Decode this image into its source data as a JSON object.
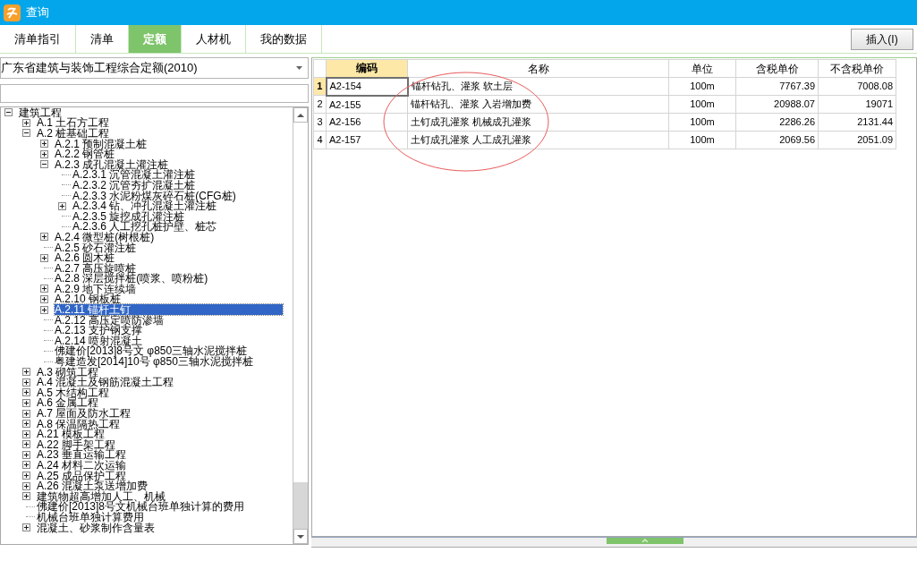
{
  "window": {
    "title": "查询"
  },
  "tabs": [
    {
      "label": "清单指引",
      "selected": false
    },
    {
      "label": "清单",
      "selected": false
    },
    {
      "label": "定额",
      "selected": true
    },
    {
      "label": "人材机",
      "selected": false
    },
    {
      "label": "我的数据",
      "selected": false
    }
  ],
  "insert_button": "插入(I)",
  "library_select": {
    "value": "广东省建筑与装饰工程综合定额(2010)"
  },
  "tree": [
    {
      "label": "建筑工程",
      "kind": "branch",
      "expanded": true,
      "selected": false,
      "children": [
        {
          "label": "A.1 土石方工程",
          "kind": "branch",
          "expanded": false,
          "selected": false
        },
        {
          "label": "A.2 桩基础工程",
          "kind": "branch",
          "expanded": true,
          "selected": false,
          "children": [
            {
              "label": "A.2.1 预制混凝土桩",
              "kind": "branch",
              "expanded": false,
              "selected": false
            },
            {
              "label": "A.2.2 钢管桩",
              "kind": "branch",
              "expanded": false,
              "selected": false
            },
            {
              "label": "A.2.3 成孔混凝土灌注桩",
              "kind": "branch",
              "expanded": true,
              "selected": false,
              "children": [
                {
                  "label": "A.2.3.1 沉管混凝土灌注桩",
                  "kind": "leaf",
                  "selected": false
                },
                {
                  "label": "A.2.3.2 沉管夯扩混凝土桩",
                  "kind": "leaf",
                  "selected": false
                },
                {
                  "label": "A.2.3.3 水泥粉煤灰碎石桩(CFG桩)",
                  "kind": "leaf",
                  "selected": false
                },
                {
                  "label": "A.2.3.4 钻、冲孔混凝土灌注桩",
                  "kind": "branch",
                  "expanded": false,
                  "selected": false
                },
                {
                  "label": "A.2.3.5 旋挖成孔灌注桩",
                  "kind": "leaf",
                  "selected": false
                },
                {
                  "label": "A.2.3.6 人工挖孔桩护壁、桩芯",
                  "kind": "leaf",
                  "selected": false
                }
              ]
            },
            {
              "label": "A.2.4 微型桩(树根桩)",
              "kind": "branch",
              "expanded": false,
              "selected": false
            },
            {
              "label": "A.2.5 砂石灌注桩",
              "kind": "leaf",
              "selected": false
            },
            {
              "label": "A.2.6 圆木桩",
              "kind": "branch",
              "expanded": false,
              "selected": false
            },
            {
              "label": "A.2.7 高压旋喷桩",
              "kind": "leaf",
              "selected": false
            },
            {
              "label": "A.2.8 深层搅拌桩(喷浆、喷粉桩)",
              "kind": "leaf",
              "selected": false
            },
            {
              "label": "A.2.9 地下连续墙",
              "kind": "branch",
              "expanded": false,
              "selected": false
            },
            {
              "label": "A.2.10 钢板桩",
              "kind": "branch",
              "expanded": false,
              "selected": false
            },
            {
              "label": "A.2.11 锚杆土钉",
              "kind": "branch",
              "expanded": false,
              "selected": true
            },
            {
              "label": "A.2.12 高压定喷防渗墙",
              "kind": "leaf",
              "selected": false
            },
            {
              "label": "A.2.13 支护钢支撑",
              "kind": "leaf",
              "selected": false
            },
            {
              "label": "A.2.14 喷射混凝土",
              "kind": "leaf",
              "selected": false
            },
            {
              "label": "佛建价[2013]8号文 φ850三轴水泥搅拌桩",
              "kind": "leaf",
              "selected": false
            },
            {
              "label": "粤建造发[2014]10号 φ850三轴水泥搅拌桩",
              "kind": "leaf",
              "selected": false
            }
          ]
        },
        {
          "label": "A.3 砌筑工程",
          "kind": "branch",
          "expanded": false,
          "selected": false
        },
        {
          "label": "A.4 混凝土及钢筋混凝土工程",
          "kind": "branch",
          "expanded": false,
          "selected": false
        },
        {
          "label": "A.5 木结构工程",
          "kind": "branch",
          "expanded": false,
          "selected": false
        },
        {
          "label": "A.6 金属工程",
          "kind": "branch",
          "expanded": false,
          "selected": false
        },
        {
          "label": "A.7 屋面及防水工程",
          "kind": "branch",
          "expanded": false,
          "selected": false
        },
        {
          "label": "A.8 保温隔热工程",
          "kind": "branch",
          "expanded": false,
          "selected": false
        },
        {
          "label": "A.21 模板工程",
          "kind": "branch",
          "expanded": false,
          "selected": false
        },
        {
          "label": "A.22 脚手架工程",
          "kind": "branch",
          "expanded": false,
          "selected": false
        },
        {
          "label": "A.23 垂直运输工程",
          "kind": "branch",
          "expanded": false,
          "selected": false
        },
        {
          "label": "A.24 材料二次运输",
          "kind": "branch",
          "expanded": false,
          "selected": false
        },
        {
          "label": "A.25 成品保护工程",
          "kind": "branch",
          "expanded": false,
          "selected": false
        },
        {
          "label": "A.26 混凝土泵送增加费",
          "kind": "branch",
          "expanded": false,
          "selected": false
        },
        {
          "label": "建筑物超高增加人工、机械",
          "kind": "branch",
          "expanded": false,
          "selected": false
        },
        {
          "label": "佛建价[2013]8号文机械台班单独计算的费用",
          "kind": "leaf",
          "selected": false
        },
        {
          "label": "机械台班单独计算费用",
          "kind": "leaf",
          "selected": false
        },
        {
          "label": "混凝土、砂浆制作含量表",
          "kind": "branch",
          "expanded": false,
          "selected": false
        }
      ]
    }
  ],
  "table": {
    "columns": [
      "编码",
      "名称",
      "单位",
      "含税单价",
      "不含税单价"
    ],
    "rows": [
      {
        "index": "1",
        "selected": true,
        "cells": [
          "A2-154",
          "锚杆钻孔、灌浆 软土层",
          "100m",
          "7767.39",
          "7008.08"
        ]
      },
      {
        "index": "2",
        "selected": false,
        "cells": [
          "A2-155",
          "锚杆钻孔、灌浆 入岩增加费",
          "100m",
          "20988.07",
          "19071"
        ]
      },
      {
        "index": "3",
        "selected": false,
        "cells": [
          "A2-156",
          "土钉成孔灌浆 机械成孔灌浆",
          "100m",
          "2286.26",
          "2131.44"
        ]
      },
      {
        "index": "4",
        "selected": false,
        "cells": [
          "A2-157",
          "土钉成孔灌浆 人工成孔灌浆",
          "100m",
          "2069.56",
          "2051.09"
        ]
      }
    ]
  }
}
